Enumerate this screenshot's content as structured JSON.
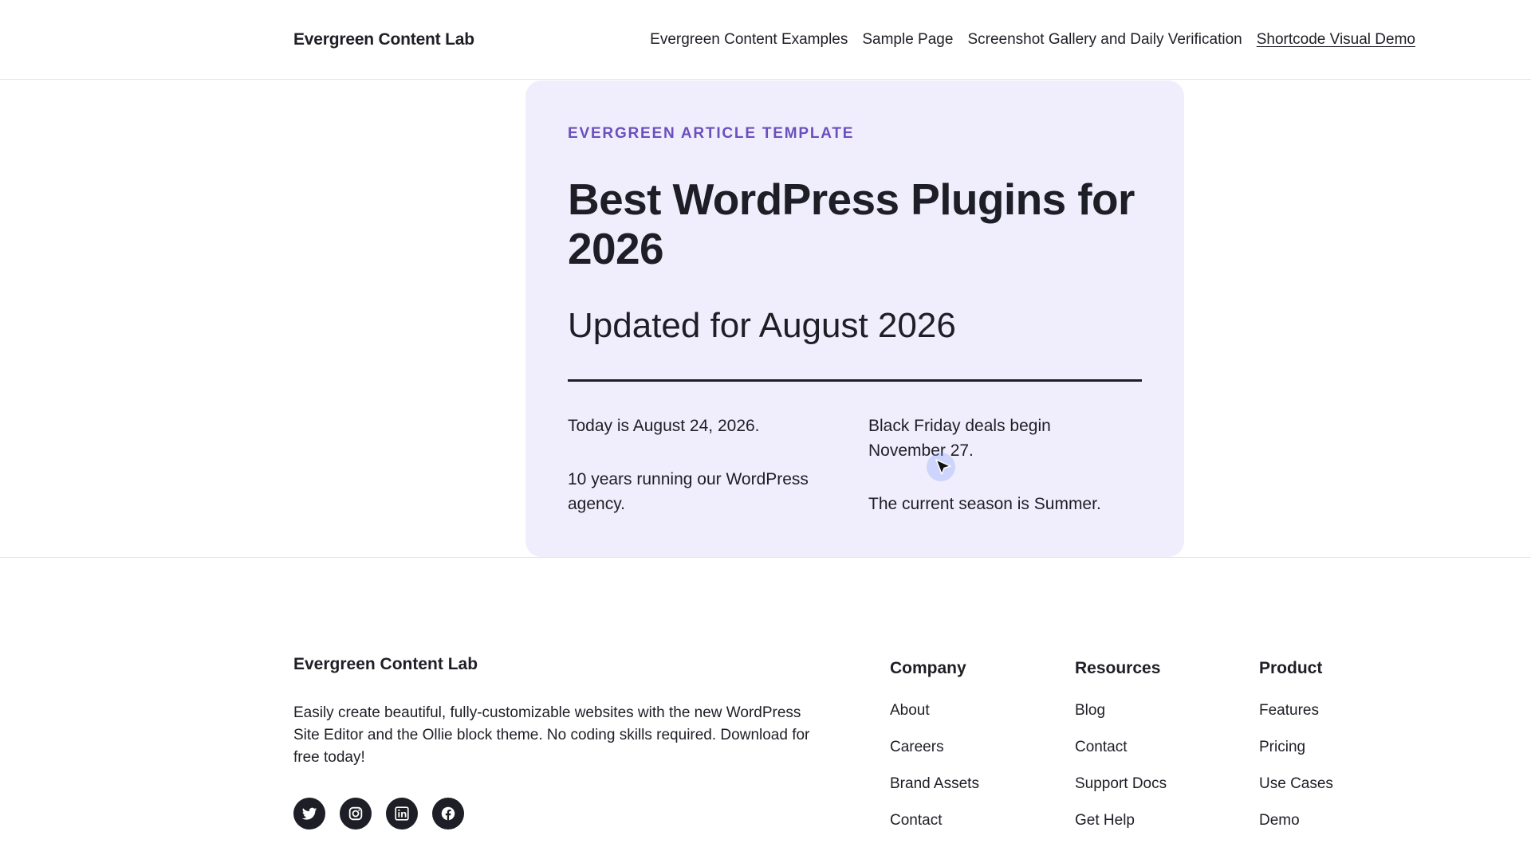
{
  "header": {
    "site_title": "Evergreen Content Lab",
    "nav": [
      {
        "label": "Evergreen Content Examples"
      },
      {
        "label": "Sample Page"
      },
      {
        "label": "Screenshot Gallery and Daily Verification"
      },
      {
        "label": "Shortcode Visual Demo"
      }
    ]
  },
  "hero": {
    "eyebrow": "EVERGREEN ARTICLE TEMPLATE",
    "headline": "Best WordPress Plugins for 2026",
    "subhead": "Updated for August 2026",
    "facts_left": [
      "Today is August 24, 2026.",
      "10 years running our WordPress agency."
    ],
    "facts_right": [
      "Black Friday deals begin November 27.",
      "The current season is Summer."
    ]
  },
  "footer": {
    "title": "Evergreen Content Lab",
    "description": "Easily create beautiful, fully-customizable websites with the new WordPress Site Editor and the Ollie block theme. No coding skills required. Download for free today!",
    "socials": [
      "twitter-icon",
      "instagram-icon",
      "linkedin-icon",
      "facebook-icon"
    ],
    "columns": [
      {
        "heading": "Company",
        "links": [
          "About",
          "Careers",
          "Brand Assets",
          "Contact"
        ]
      },
      {
        "heading": "Resources",
        "links": [
          "Blog",
          "Contact",
          "Support Docs",
          "Get Help"
        ]
      },
      {
        "heading": "Product",
        "links": [
          "Features",
          "Pricing",
          "Use Cases",
          "Demo"
        ]
      }
    ]
  },
  "colors": {
    "accent": "#6a4fbe",
    "card_bg": "#f0eefc",
    "text": "#1e1e26"
  }
}
